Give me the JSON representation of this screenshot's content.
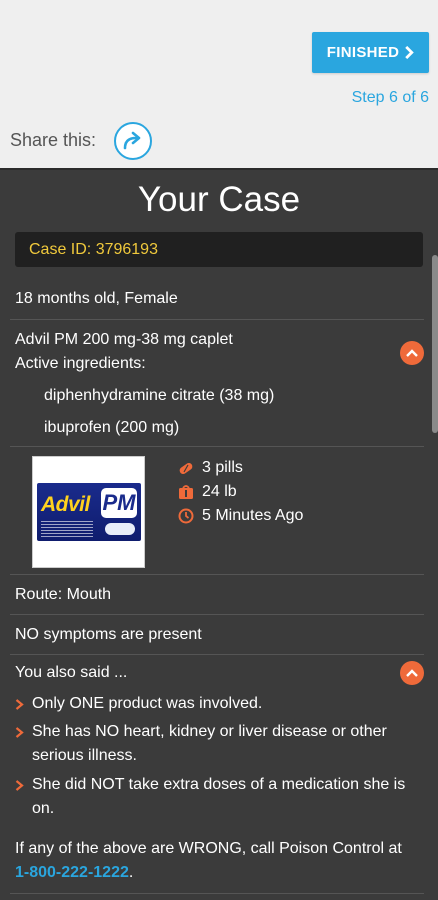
{
  "header": {
    "finished_label": "FINISHED",
    "step_text": "Step 6 of 6",
    "share_label": "Share this:"
  },
  "case": {
    "title": "Your Case",
    "case_id": "Case ID: 3796193",
    "patient": "18 months old, Female",
    "product_name": "Advil PM 200 mg-38 mg caplet",
    "active_ingredients_label": "Active ingredients:",
    "ingredients": [
      "diphenhydramine citrate (38 mg)",
      "ibuprofen (200 mg)"
    ],
    "product_image_brand": "Advil",
    "product_image_suffix": "PM",
    "amount": "3 pills",
    "weight": "24 lb",
    "time": "5 Minutes Ago",
    "route": "Route: Mouth",
    "symptoms": "NO symptoms are present",
    "also_said_label": "You also said ...",
    "statements": [
      "Only ONE product was involved.",
      "She has NO heart, kidney or liver disease or other serious illness.",
      "She did NOT take extra doses of a medication she is on."
    ],
    "wrong_prefix": "If any of the above are WRONG, call Poison Control at",
    "phone": "1-800-222-1222",
    "wrong_suffix": "."
  },
  "colors": {
    "accent": "#2aa6df",
    "orange": "#ef6a3a",
    "case_id_text": "#f0c93c",
    "panel_bg": "#3b3b3b"
  },
  "icons": [
    "chevron-right-icon",
    "share-arrow-icon",
    "collapse-chevron-up-icon",
    "pill-icon",
    "weight-icon",
    "clock-icon"
  ]
}
